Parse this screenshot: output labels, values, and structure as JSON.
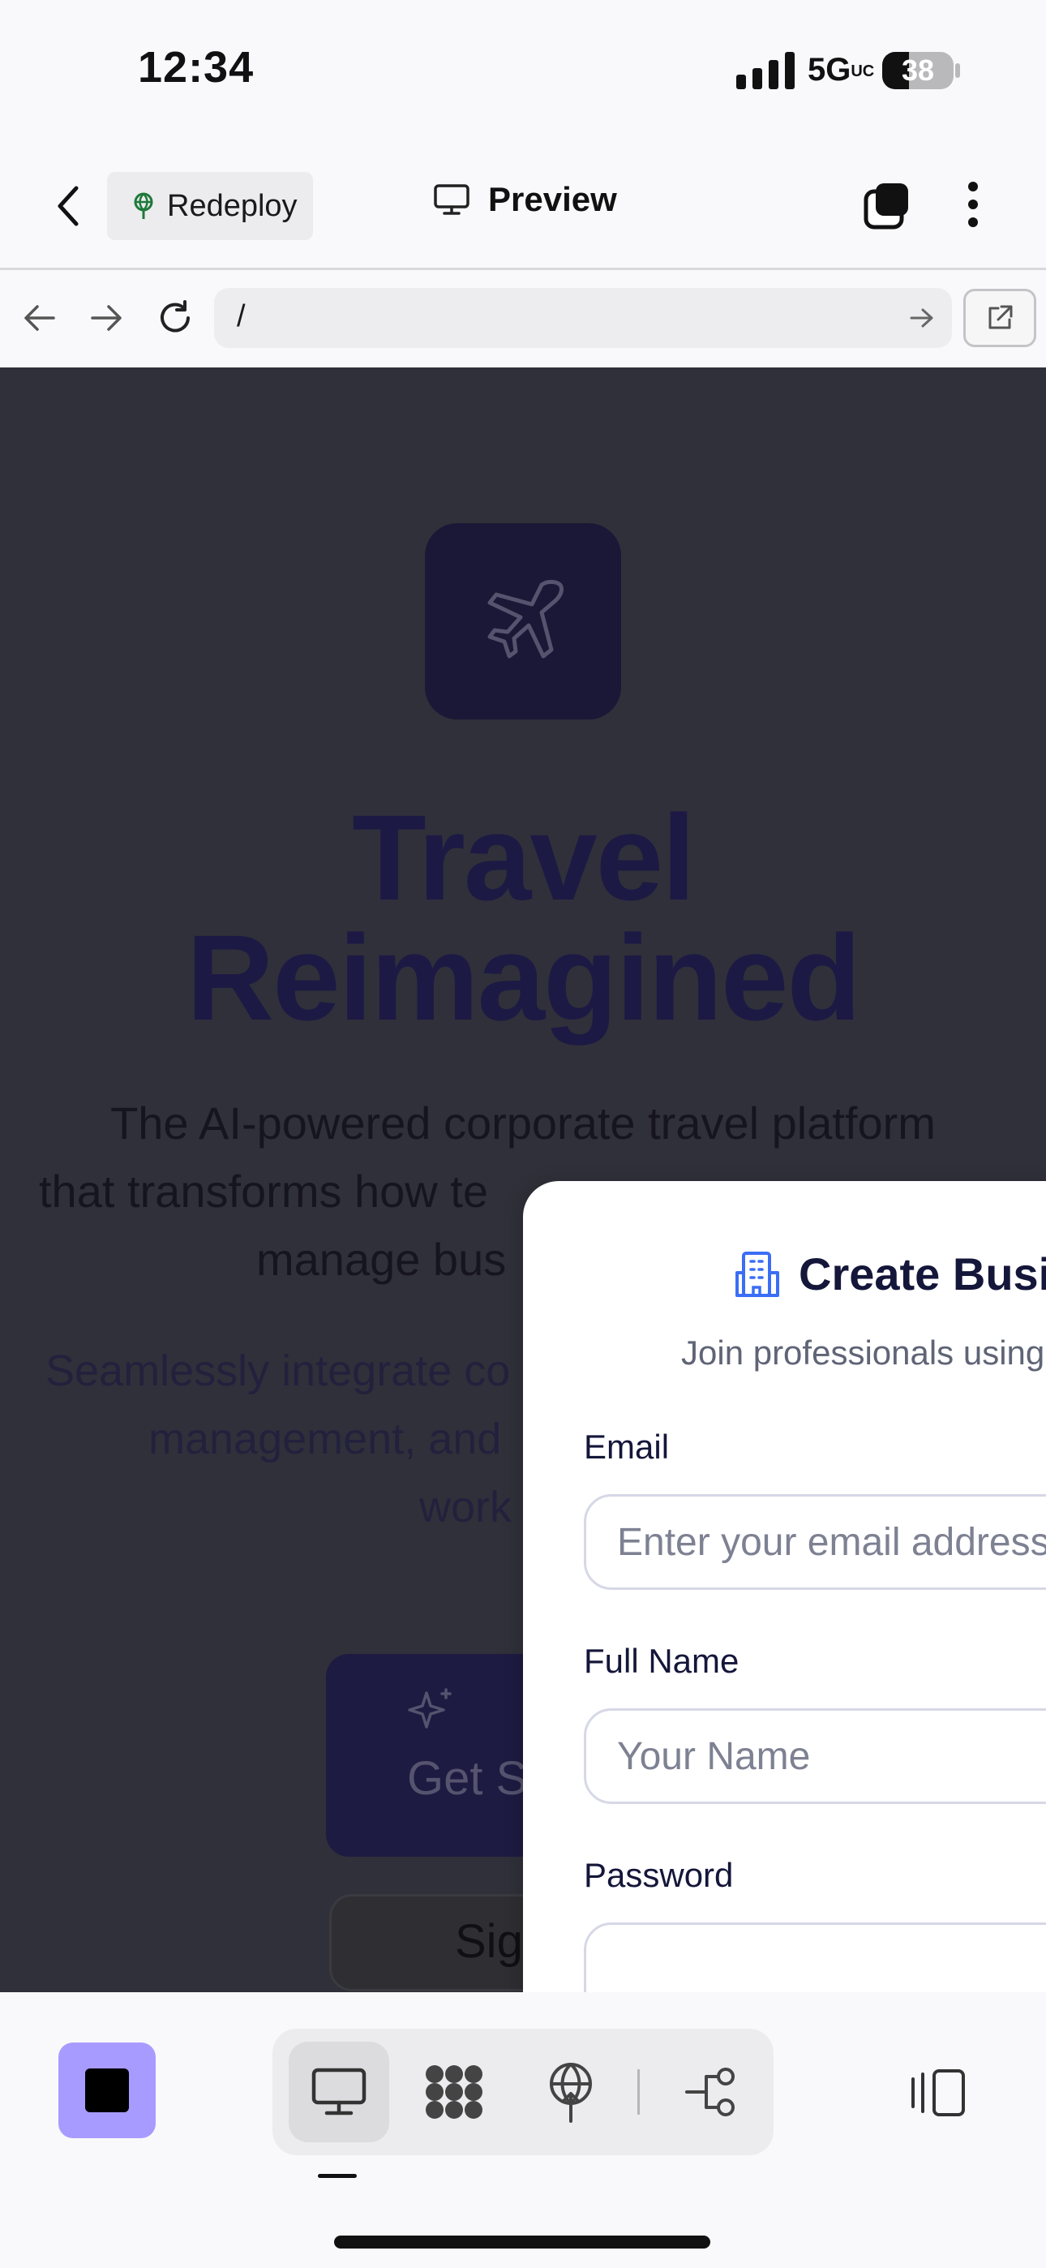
{
  "status_bar": {
    "time": "12:34",
    "network": "5G",
    "network_suffix": "UC",
    "battery": "38",
    "battery_level": 0.38
  },
  "app_bar": {
    "redeploy_label": "Redeploy",
    "title": "Preview"
  },
  "browser": {
    "url": "/"
  },
  "landing": {
    "title_line1": "Travel",
    "title_line2": "Reimagined",
    "subtitle_line1": "The AI-powered corporate travel platform",
    "subtitle_line2": "that transforms how te",
    "subtitle_line2_tail": "                            ",
    "subtitle_line3": "manage bus",
    "body_line1": "Seamlessly integrate co",
    "body_line2": "management, and",
    "body_line3": "work",
    "cta_start": "Get St",
    "cta_signin": "Sig"
  },
  "modal": {
    "title": "Create Busin",
    "subtitle": "Join professionals using",
    "email_label": "Email",
    "email_placeholder": "Enter your email address",
    "name_label": "Full Name",
    "name_placeholder": "Your Name",
    "password_label": "Password"
  },
  "colors": {
    "accent": "#a89bff",
    "modal_title": "#14163a",
    "hero_title": "#1c1a44",
    "overlay": "#30303a"
  }
}
